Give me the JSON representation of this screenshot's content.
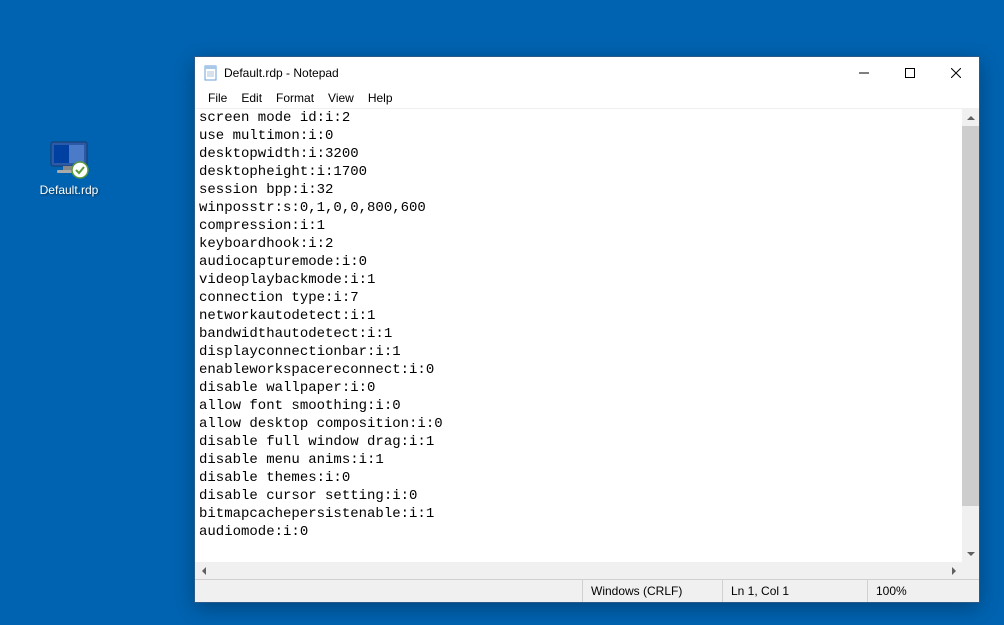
{
  "desktop": {
    "icon_label": "Default.rdp"
  },
  "window": {
    "title": "Default.rdp - Notepad",
    "menu": {
      "file": "File",
      "edit": "Edit",
      "format": "Format",
      "view": "View",
      "help": "Help"
    },
    "content": "screen mode id:i:2\nuse multimon:i:0\ndesktopwidth:i:3200\ndesktopheight:i:1700\nsession bpp:i:32\nwinposstr:s:0,1,0,0,800,600\ncompression:i:1\nkeyboardhook:i:2\naudiocapturemode:i:0\nvideoplaybackmode:i:1\nconnection type:i:7\nnetworkautodetect:i:1\nbandwidthautodetect:i:1\ndisplayconnectionbar:i:1\nenableworkspacereconnect:i:0\ndisable wallpaper:i:0\nallow font smoothing:i:0\nallow desktop composition:i:0\ndisable full window drag:i:1\ndisable menu anims:i:1\ndisable themes:i:0\ndisable cursor setting:i:0\nbitmapcachepersistenable:i:1\naudiomode:i:0\n",
    "status": {
      "encoding": "Windows (CRLF)",
      "position": "Ln 1, Col 1",
      "zoom": "100%"
    }
  }
}
